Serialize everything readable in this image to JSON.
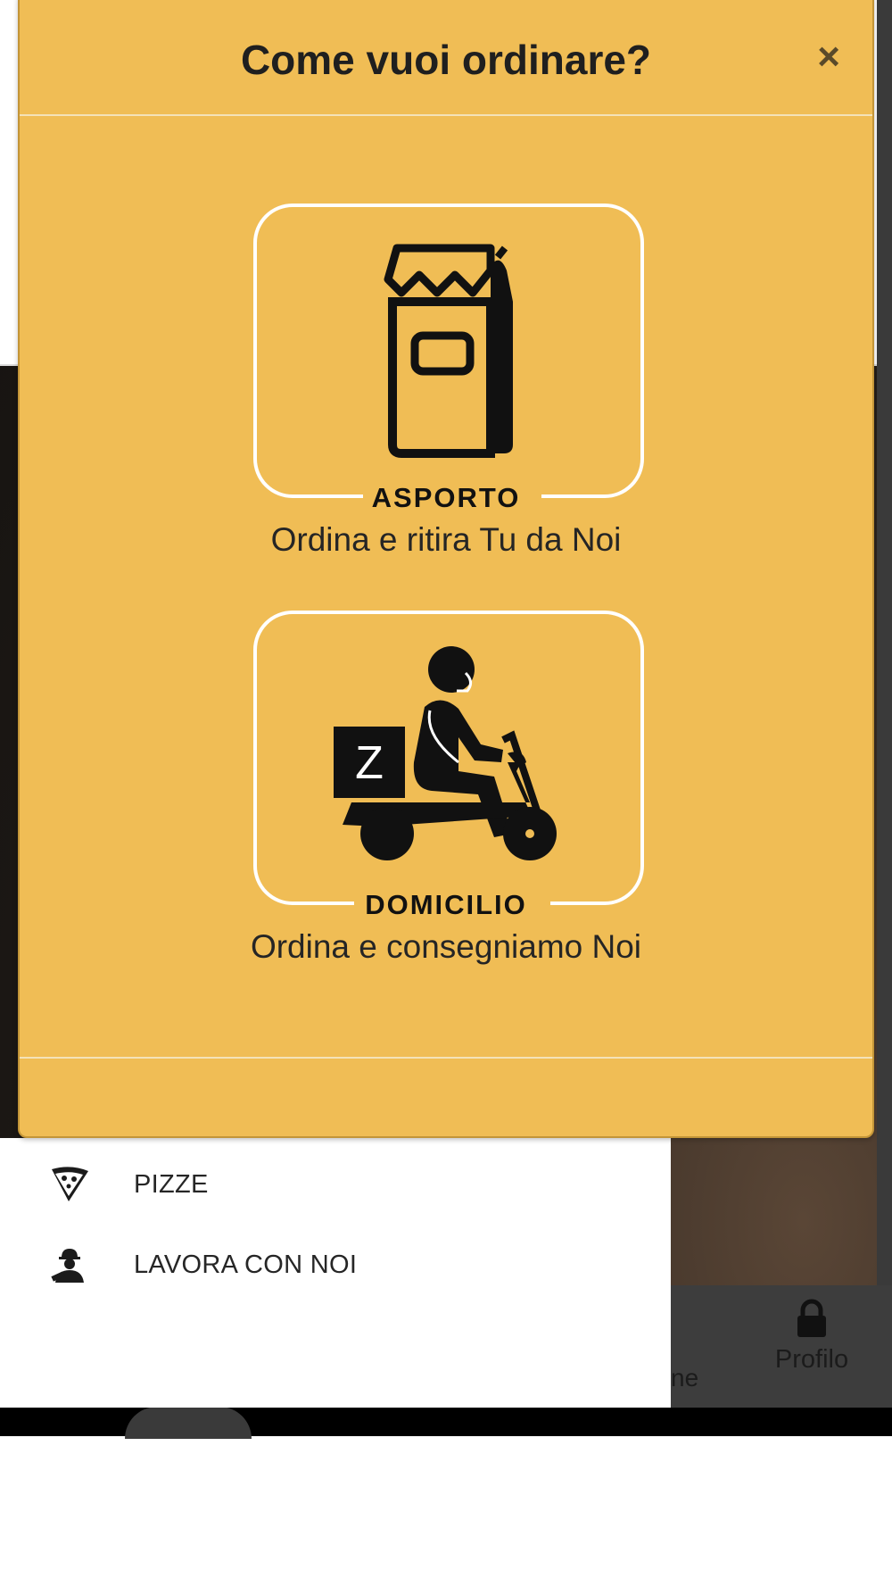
{
  "modal": {
    "title": "Come vuoi ordinare?",
    "close_icon": "×",
    "options": [
      {
        "icon": "bag-icon",
        "label": "ASPORTO",
        "subtitle": "Ordina e ritira Tu da Noi"
      },
      {
        "icon": "scooter-icon",
        "label": "DOMICILIO",
        "subtitle": "Ordina e consegniamo Noi",
        "box_letter": "Z"
      }
    ]
  },
  "drawer": {
    "items": [
      {
        "icon": "pizza-slice-icon",
        "label": "PIZZE"
      },
      {
        "icon": "worker-icon",
        "label": "LAVORA CON NOI"
      }
    ]
  },
  "bottom_nav": {
    "partial_label": "ne",
    "profile_icon": "lock-icon",
    "profile_label": "Profilo"
  },
  "colors": {
    "modal_bg": "#f0bd55",
    "nav_bg": "#3d3d3d"
  }
}
